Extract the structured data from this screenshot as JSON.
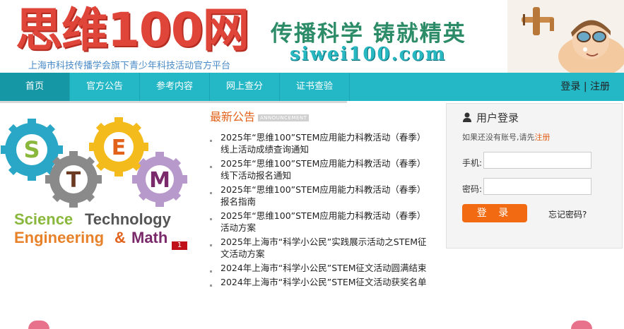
{
  "header": {
    "logo_text": "思维100网",
    "logo_subtitle": "上海市科技传播学会旗下青少年科技活动官方平台",
    "slogan": "传播科学 铸就精英",
    "domain_text": "siwei100.com"
  },
  "nav": {
    "items": [
      {
        "label": "首页",
        "active": true
      },
      {
        "label": "官方公告",
        "active": false
      },
      {
        "label": "参考内容",
        "active": false
      },
      {
        "label": "网上查分",
        "active": false
      },
      {
        "label": "证书查验",
        "active": false
      }
    ],
    "login_link": "登录",
    "separator": "|",
    "register_link": "注册"
  },
  "stem": {
    "letters": [
      "S",
      "T",
      "E",
      "M"
    ],
    "line1_a": "Science",
    "line1_b": "Technology",
    "line2_a": "Engineering",
    "line2_amp": "&",
    "line2_b": "Math",
    "badge": "1"
  },
  "news": {
    "title": "最新公告",
    "tag": "ANNOUNCEMENT",
    "items": [
      "2025年“思维100”STEM应用能力科教活动（春季）线上活动成绩查询通知",
      "2025年“思维100”STEM应用能力科教活动（春季） 线下活动报名通知",
      "2025年“思维100”STEM应用能力科教活动（春季）报名指南",
      "2025年“思维100”STEM应用能力科教活动（春季）活动方案",
      "2025年上海市“科学小公民”实践展示活动之STEM征文活动方案",
      "2024年上海市“科学小公民”STEM征文活动圆满结束",
      "2024年上海市“科学小公民”STEM征文活动获奖名单"
    ]
  },
  "login": {
    "title": "用户登录",
    "tip_prefix": "如果还没有账号,请先",
    "tip_link": "注册",
    "phone_label": "手机:",
    "password_label": "密码:",
    "login_button": "登 录",
    "forgot_link": "忘记密码?"
  },
  "colors": {
    "nav_bg": "#24b8c6",
    "accent_orange": "#f26b12",
    "logo_red": "#e0453a",
    "slogan_green": "#2c8c67"
  },
  "icons": [
    "user-icon",
    "propeller-plane-icon"
  ]
}
